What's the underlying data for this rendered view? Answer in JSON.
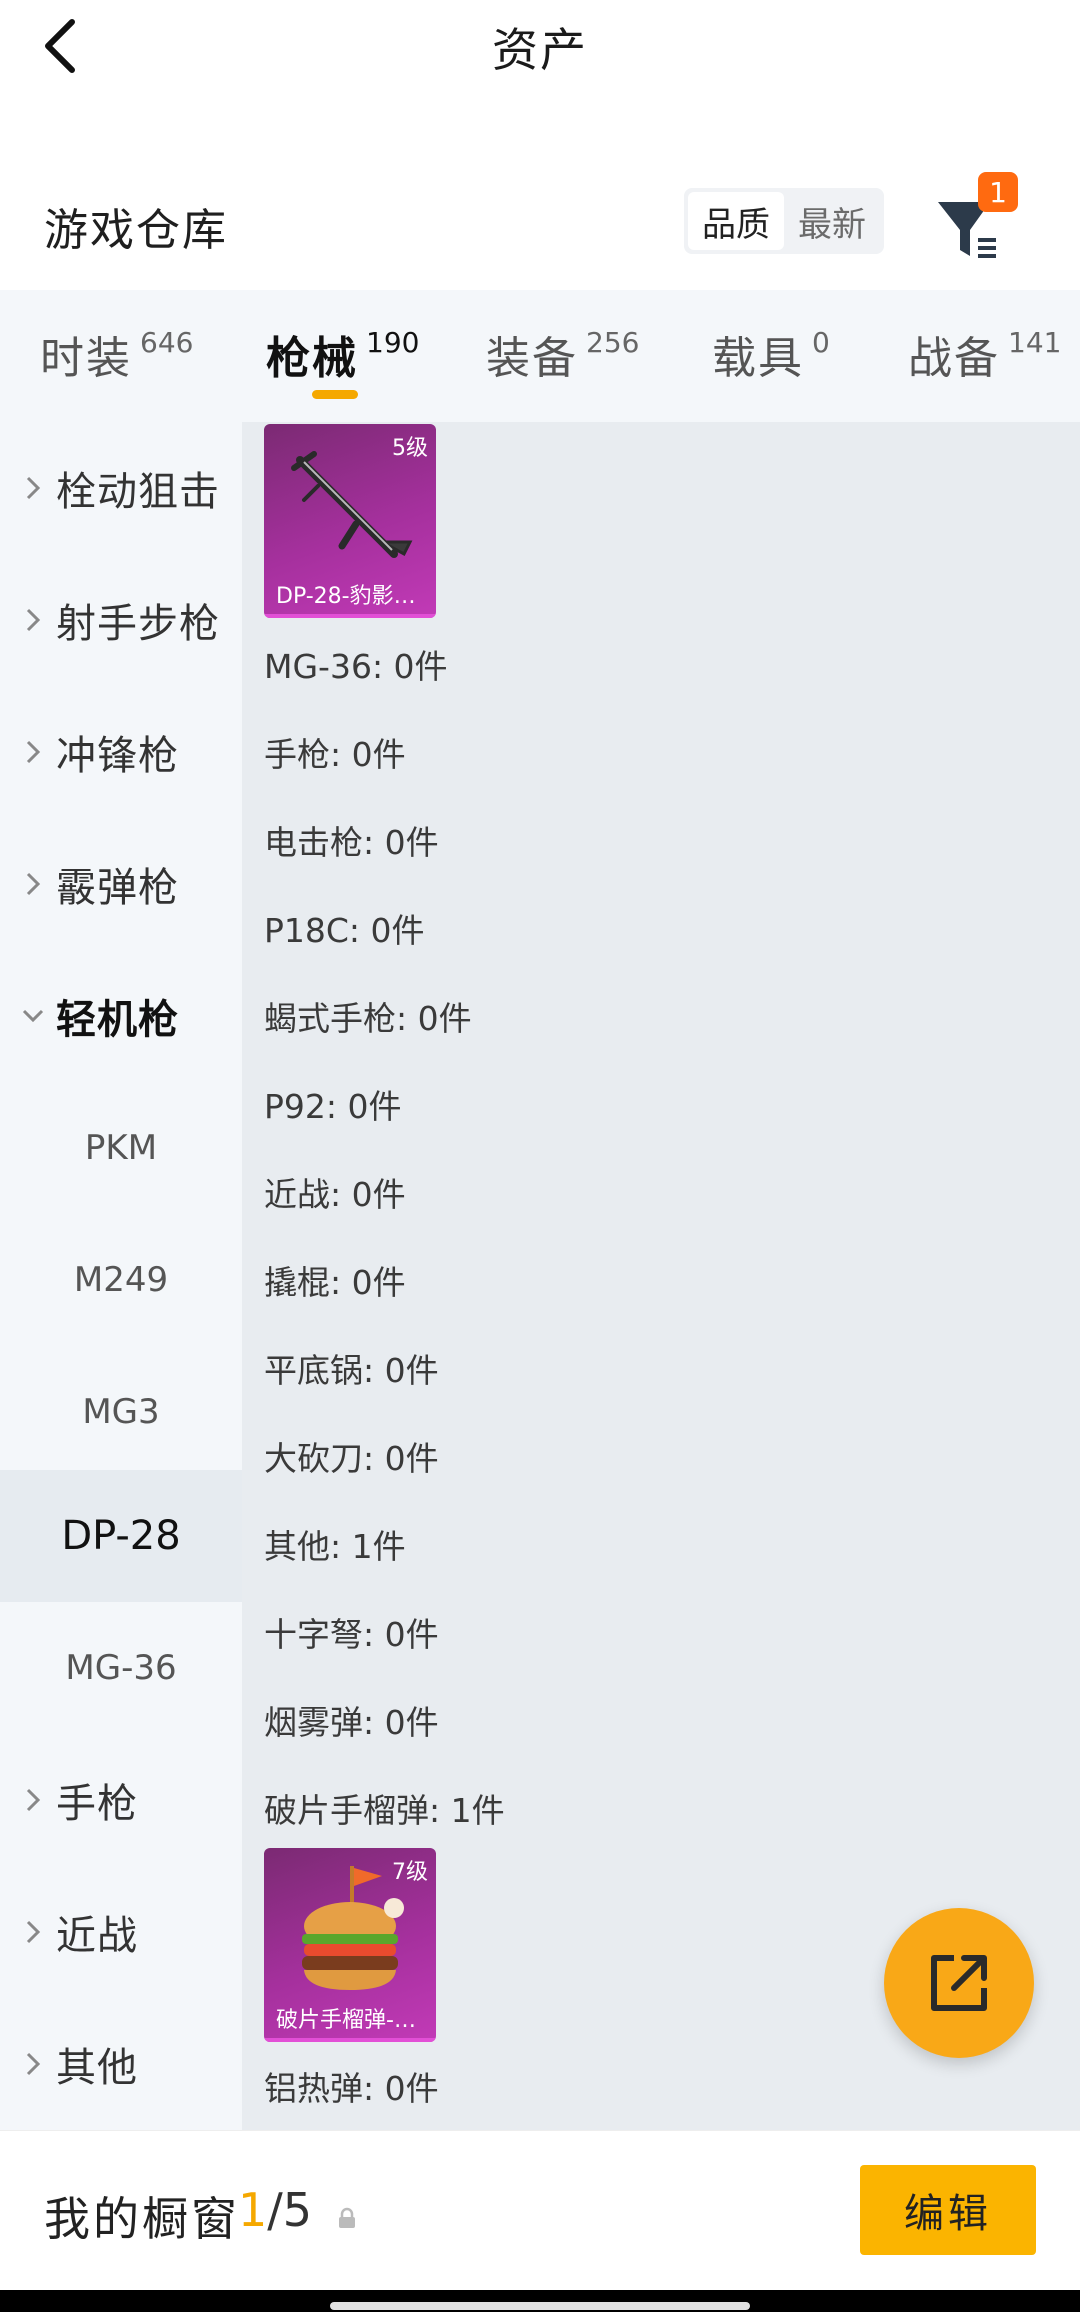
{
  "header": {
    "title": "资产"
  },
  "warehouse": {
    "title": "游戏仓库",
    "sort_options": [
      "品质",
      "最新"
    ],
    "filter_badge": "1"
  },
  "tabs": [
    {
      "label": "时装",
      "count": "646"
    },
    {
      "label": "枪械",
      "count": "190"
    },
    {
      "label": "装备",
      "count": "256"
    },
    {
      "label": "载具",
      "count": "0"
    },
    {
      "label": "战备",
      "count": "141"
    }
  ],
  "sidebar": {
    "categories": [
      "栓动狙击",
      "射手步枪",
      "冲锋枪",
      "霰弹枪",
      "轻机枪"
    ],
    "subitems": [
      "PKM",
      "M249",
      "MG3",
      "DP-28",
      "MG-36"
    ],
    "more_categories": [
      "手枪",
      "近战",
      "其他"
    ]
  },
  "content": {
    "card1": {
      "level": "5级",
      "name": "DP-28-豹影…"
    },
    "rows": [
      "MG-36: 0件",
      "手枪: 0件",
      "电击枪: 0件",
      "P18C: 0件",
      "蝎式手枪: 0件",
      "P92: 0件",
      "近战: 0件",
      "撬棍: 0件",
      "平底锅: 0件",
      "大砍刀: 0件",
      "其他: 1件",
      "十字弩: 0件",
      "烟雾弹: 0件",
      "破片手榴弹: 1件"
    ],
    "card2": {
      "level": "7级",
      "name": "破片手榴弹-…"
    },
    "last_row": "铝热弹: 0件"
  },
  "bottom": {
    "title": "我的橱窗",
    "current": "1",
    "total": "/5",
    "edit_label": "编辑"
  },
  "colors": {
    "accent": "#f5a800",
    "badge": "#ff6a10",
    "card": "#a5309d"
  }
}
